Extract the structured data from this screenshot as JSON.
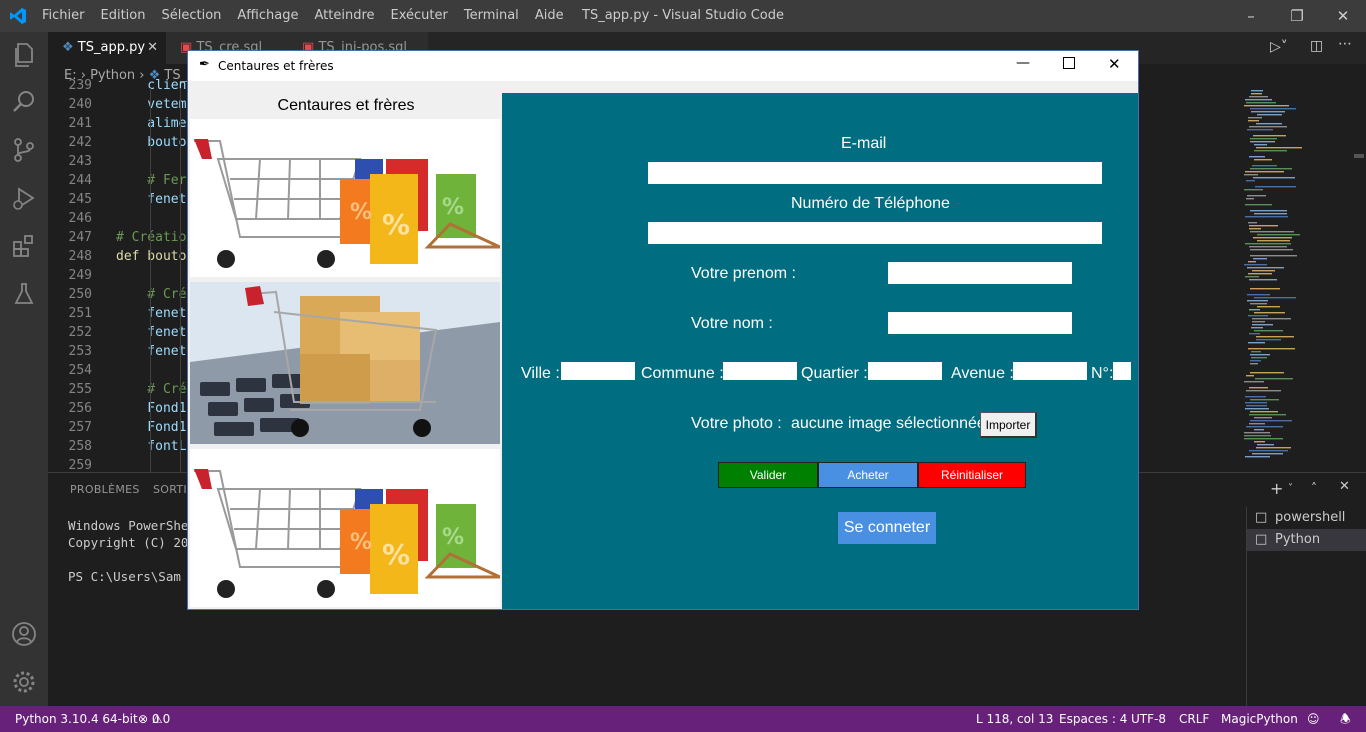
{
  "vscode": {
    "menu": [
      "Fichier",
      "Edition",
      "Sélection",
      "Affichage",
      "Atteindre",
      "Exécuter",
      "Terminal",
      "Aide"
    ],
    "window_title": "TS_app.py - Visual Studio Code",
    "tabs": [
      {
        "label": "TS_app.py",
        "active": true
      },
      {
        "label": "TS_cre.sql",
        "active": false
      },
      {
        "label": "TS_ini-pos.sql",
        "active": false
      }
    ],
    "breadcrumb": [
      "E:",
      "Python",
      "TS_"
    ],
    "code_lines": [
      {
        "n": "239",
        "text": "    clien",
        "color": "#9cdcfe"
      },
      {
        "n": "240",
        "text": "    veteme",
        "color": "#9cdcfe"
      },
      {
        "n": "241",
        "text": "    alimen",
        "color": "#9cdcfe"
      },
      {
        "n": "242",
        "text": "    bouto",
        "color": "#9cdcfe"
      },
      {
        "n": "243",
        "text": "",
        "color": "#d4d4d4"
      },
      {
        "n": "244",
        "text": "    # Fer",
        "color": "#6a9955"
      },
      {
        "n": "245",
        "text": "    fenetr",
        "color": "#9cdcfe"
      },
      {
        "n": "246",
        "text": "",
        "color": "#d4d4d4"
      },
      {
        "n": "247",
        "text": "# Création",
        "color": "#6a9955"
      },
      {
        "n": "248",
        "text": "def bouto",
        "color": "#dcdcaa"
      },
      {
        "n": "249",
        "text": "",
        "color": "#d4d4d4"
      },
      {
        "n": "250",
        "text": "    # Cré",
        "color": "#6a9955"
      },
      {
        "n": "251",
        "text": "    fenetr",
        "color": "#9cdcfe"
      },
      {
        "n": "252",
        "text": "    fenetr",
        "color": "#9cdcfe"
      },
      {
        "n": "253",
        "text": "    fenetr",
        "color": "#9cdcfe"
      },
      {
        "n": "254",
        "text": "",
        "color": "#d4d4d4"
      },
      {
        "n": "255",
        "text": "    # Cré",
        "color": "#6a9955"
      },
      {
        "n": "256",
        "text": "    Fond1",
        "color": "#9cdcfe"
      },
      {
        "n": "257",
        "text": "    Fond1",
        "color": "#9cdcfe"
      },
      {
        "n": "258",
        "text": "    fontL",
        "color": "#9cdcfe"
      },
      {
        "n": "259",
        "text": "",
        "color": "#d4d4d4"
      }
    ],
    "panel_tabs": [
      "PROBLÈMES",
      "SORTIE"
    ],
    "terminal_lines": [
      "Windows PowerShel",
      "Copyright (C) 201",
      "",
      "PS C:\\Users\\Sam O"
    ],
    "terminal_list": [
      "powershell",
      "Python"
    ],
    "status": {
      "python": "Python 3.10.4 64-bit",
      "errors": "0",
      "warnings": "0",
      "position": "L 118, col 13",
      "spaces": "Espaces : 4",
      "encoding": "UTF-8",
      "eol": "CRLF",
      "language": "MagicPython"
    }
  },
  "app": {
    "window_title": "Centaures et frères",
    "header": "Centaures et frères",
    "labels": {
      "email": "E-mail",
      "phone": "Numéro de Téléphone",
      "prenom": "Votre prenom :",
      "nom": "Votre nom :",
      "ville": "Ville :",
      "commune": "Commune :",
      "quartier": "Quartier :",
      "avenue": "Avenue :",
      "numero": "N°:",
      "photo": "Votre photo :",
      "photo_status": "aucune image sélectionnée"
    },
    "buttons": {
      "importer": "Importer",
      "valider": "Valider",
      "acheter": "Acheter",
      "reinitialiser": "Réinitialiser",
      "connect": "Se conneter"
    },
    "colors": {
      "panel_bg": "#006e80",
      "valider": "#008000",
      "acheter": "#4a90e2",
      "reinitialiser": "#ff0000",
      "connect": "#4a90e2"
    }
  }
}
